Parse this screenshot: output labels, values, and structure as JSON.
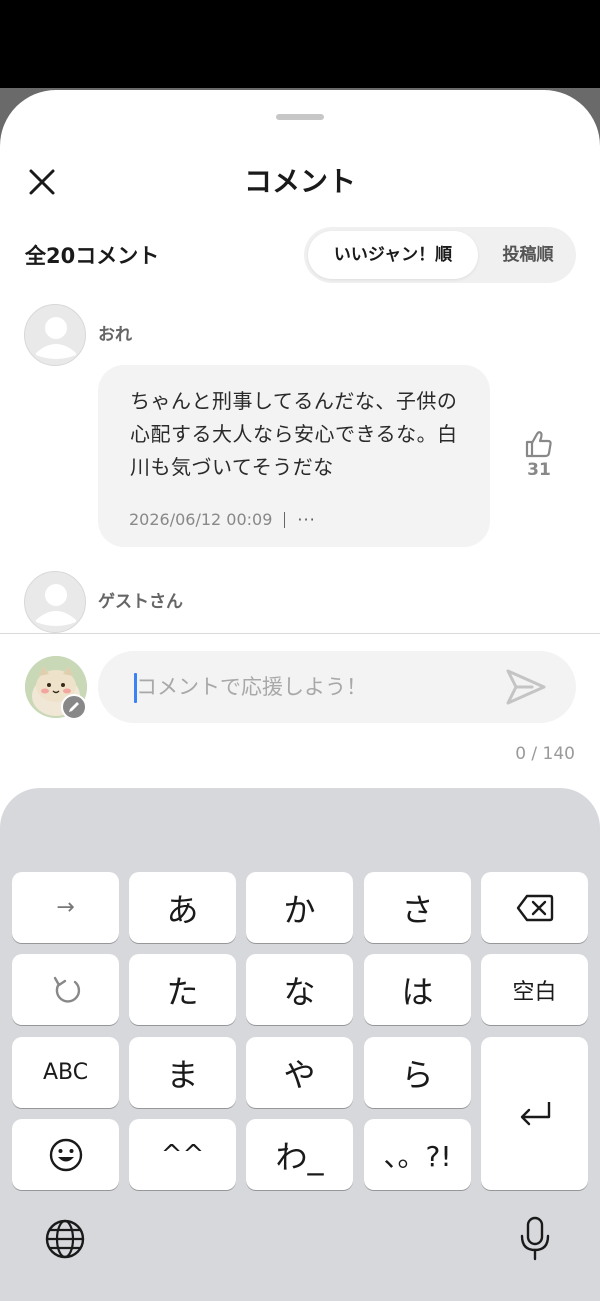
{
  "header": {
    "title": "コメント",
    "close_label": "close"
  },
  "summary": {
    "count_label": "全20コメント",
    "sort_options": [
      "いいジャン！順",
      "投稿順"
    ],
    "sort_active_index": 0
  },
  "comments": [
    {
      "author": "おれ",
      "text": "ちゃんと刑事してるんだな、子供の心配する大人なら安心できるな。白川も気づいてそうだな",
      "timestamp": "2026/06/12 00:09",
      "more_label": "···",
      "like_count": "31"
    },
    {
      "author": "ゲストさん"
    }
  ],
  "composer": {
    "placeholder": "コメントで応援しよう！",
    "char_count": "0 / 140"
  },
  "keyboard": {
    "row1": [
      "→",
      "あ",
      "か",
      "さ",
      "⌫"
    ],
    "row2": [
      "↺",
      "た",
      "な",
      "は",
      "空白"
    ],
    "row3": [
      "ABC",
      "ま",
      "や",
      "ら"
    ],
    "row4": [
      "☺",
      "^^",
      "わ_",
      "、。?!"
    ],
    "return_icon": "return-icon",
    "globe_icon": "globe-icon",
    "mic_icon": "microphone-icon"
  },
  "colors": {
    "caret": "#3b82f6",
    "keyboard_bg": "#d6d8dc"
  }
}
